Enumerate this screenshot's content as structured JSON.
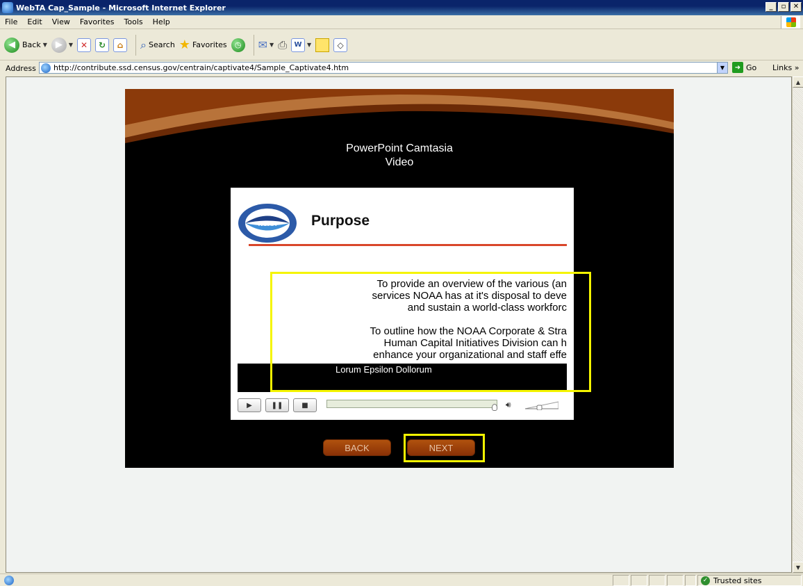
{
  "window": {
    "title": "WebTA Cap_Sample - Microsoft Internet Explorer",
    "buttons": [
      "_",
      "▫",
      "✕"
    ]
  },
  "menu": [
    "File",
    "Edit",
    "View",
    "Favorites",
    "Tools",
    "Help"
  ],
  "toolbar": {
    "back_label": "Back",
    "search_label": "Search",
    "favorites_label": "Favorites"
  },
  "address": {
    "label": "Address",
    "url": "http://contribute.ssd.census.gov/centrain/captivate4/Sample_Captivate4.htm",
    "go_label": "Go",
    "links_label": "Links »"
  },
  "player": {
    "title_line1": "PowerPoint Camtasia",
    "title_line2": "Video",
    "slide": {
      "logo_text": "NOAA",
      "heading": "Purpose",
      "body_lines": [
        "To provide an overview of the various (an",
        "services NOAA has at it's disposal to deve",
        "and sustain a world-class workforc",
        "",
        "To outline how the NOAA Corporate & Stra",
        "Human Capital Initiatives Division can h",
        "enhance your organizational and staff effe"
      ],
      "caption": "Lorum Epsilon Dollorum"
    },
    "back_label": "BACK",
    "next_label": "NEXT",
    "colors": {
      "banner": "#8b3a0a",
      "highlight": "#f5f500",
      "button": "#a0440c"
    }
  },
  "status": {
    "zone": "Trusted sites"
  }
}
